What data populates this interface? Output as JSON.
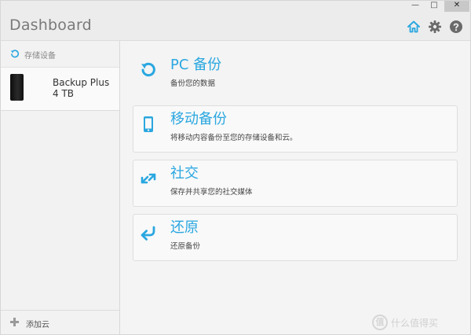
{
  "window": {
    "title": "Dashboard",
    "controls": {
      "minimize": "—",
      "maximize": "□",
      "close": "✕"
    }
  },
  "toolbar": {
    "icons": [
      "home-icon",
      "gear-icon",
      "help-icon"
    ],
    "accent_color": "#2aa7e0"
  },
  "sidebar": {
    "section_label": "存储设备",
    "device": {
      "name": "Backup Plus",
      "capacity": "4 TB"
    },
    "footer_label": "添加云"
  },
  "cards": [
    {
      "icon": "backup-icon",
      "title": "PC 备份",
      "subtitle": "备份您的数据"
    },
    {
      "icon": "mobile-icon",
      "title": "移动备份",
      "subtitle": "将移动内容备份至您的存储设备和云。"
    },
    {
      "icon": "share-icon",
      "title": "社交",
      "subtitle": "保存并共享您的社交媒体"
    },
    {
      "icon": "restore-icon",
      "title": "还原",
      "subtitle": "还原备份"
    }
  ],
  "watermark": {
    "text": "什么值得买",
    "badge": "值"
  }
}
